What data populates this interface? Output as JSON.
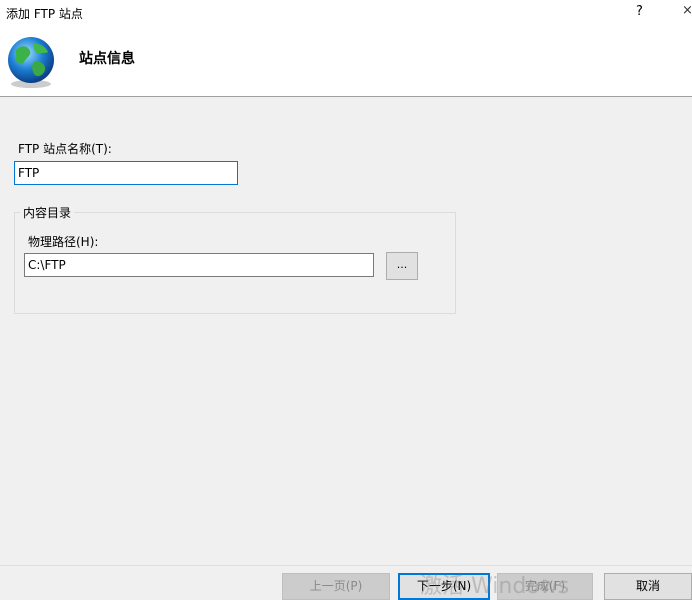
{
  "window": {
    "title": "添加 FTP 站点",
    "help_label": "?",
    "close_label": "×"
  },
  "header": {
    "title": "站点信息",
    "icon": "globe-icon"
  },
  "form": {
    "site_name_label": "FTP 站点名称(T):",
    "site_name_value": "FTP",
    "group_label": "内容目录",
    "path_label": "物理路径(H):",
    "path_value": "C:\\FTP",
    "browse_label": "..."
  },
  "buttons": {
    "prev": "上一页(P)",
    "next": "下一步(N)",
    "finish": "完成(F)",
    "cancel": "取消"
  },
  "watermark": "激活 Windows"
}
